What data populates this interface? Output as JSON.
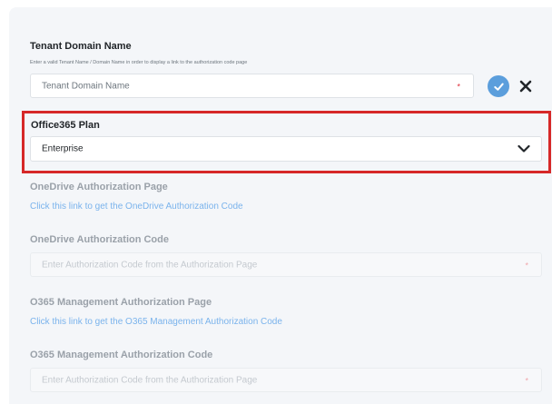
{
  "tenant": {
    "label": "Tenant Domain Name",
    "helper": "Enter a valid Tenant Name / Domain Name in order to display a link to the authorization code page",
    "placeholder": "Tenant Domain Name",
    "required_mark": "*"
  },
  "plan": {
    "label": "Office365 Plan",
    "selected": "Enterprise"
  },
  "onedrive_page": {
    "label": "OneDrive Authorization Page",
    "link": "Click this link to get the OneDrive Authorization Code"
  },
  "onedrive_code": {
    "label": "OneDrive Authorization Code",
    "placeholder": "Enter Authorization Code from the Authorization Page",
    "required_mark": "*"
  },
  "o365_page": {
    "label": "O365 Management Authorization Page",
    "link": "Click this link to get the O365 Management Authorization Code"
  },
  "o365_code": {
    "label": "O365 Management Authorization Code",
    "placeholder": "Enter Authorization Code from the Authorization Page",
    "required_mark": "*"
  },
  "colors": {
    "highlight": "#d62828",
    "confirm": "#5b9edc",
    "link": "#7ab3ec",
    "required": "#e0323c"
  },
  "icons": {
    "confirm": "check-icon",
    "cancel": "close-icon",
    "dropdown": "chevron-down-icon"
  }
}
